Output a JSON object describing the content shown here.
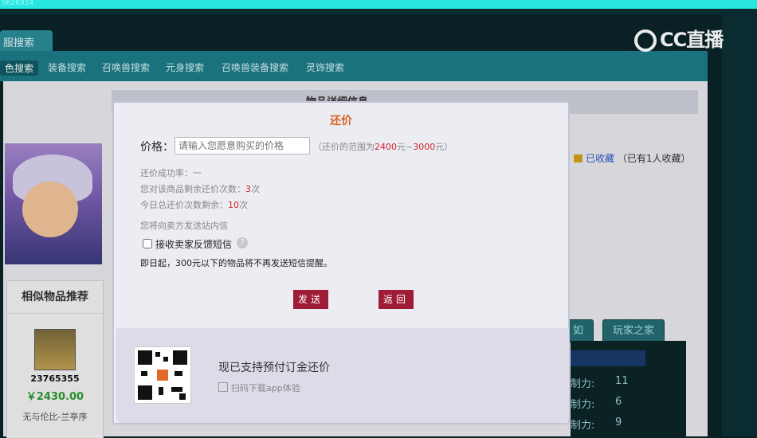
{
  "topbar": {
    "watermark": "9626934"
  },
  "header": {
    "tab_label": "服搜索"
  },
  "nav": [
    "色搜索",
    "装备搜索",
    "召唤兽搜索",
    "元身搜索",
    "召唤兽装备搜索",
    "灵饰搜索"
  ],
  "detail": {
    "header_title": "物品详细信息"
  },
  "favorite": {
    "link": "已收藏",
    "count_text": "（已有1人收藏）"
  },
  "similar": {
    "title": "相似物品推荐",
    "item_id": "23765355",
    "price": "￥2430.00",
    "server": "无与伦比-兰亭序"
  },
  "right_tabs": [
    "如",
    "玩家之家"
  ],
  "right_rows": [
    {
      "label": "制力:",
      "value": "11"
    },
    {
      "label": "制力:",
      "value": "6"
    },
    {
      "label": "制力:",
      "value": "9"
    }
  ],
  "logo": {
    "text": "CC直播"
  },
  "modal": {
    "title": "还价",
    "price_label": "价格：",
    "price_placeholder": "请输入您愿意购买的价格",
    "range_prefix": "（还价的范围为",
    "range_min": "2400",
    "range_mid": "元~",
    "range_max": "3000",
    "range_suffix": "元）",
    "success_rate": "还价成功率：一",
    "remain_item_prefix": "您对该商品剩余还价次数：",
    "remain_item_value": "3",
    "remain_item_suffix": "次",
    "remain_today_prefix": "今日总还价次数剩余：",
    "remain_today_value": "10",
    "remain_today_suffix": "次",
    "pm_note": "您将向卖方发送站内信",
    "checkbox_label": "接收卖家反馈短信",
    "notice": "即日起，300元以下的物品将不再发送短信提醒。",
    "send_button": "发送",
    "back_button": "返回",
    "footer_title": "现已支持预付订金还价",
    "footer_sub": "扫码下载app体验"
  }
}
